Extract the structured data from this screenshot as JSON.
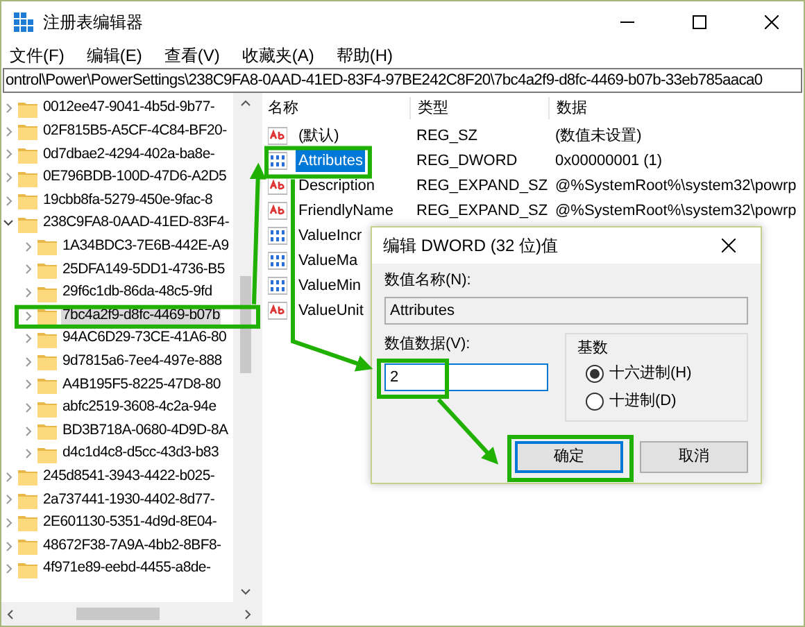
{
  "window": {
    "title": "注册表编辑器"
  },
  "menu": [
    "文件(F)",
    "编辑(E)",
    "查看(V)",
    "收藏夹(A)",
    "帮助(H)"
  ],
  "address": "ontrol\\Power\\PowerSettings\\238C9FA8-0AAD-41ED-83F4-97BE242C8F20\\7bc4a2f9-d8fc-4469-b07b-33eb785aaca0",
  "tree": {
    "items": [
      {
        "label": "0012ee47-9041-4b5d-9b77-",
        "expanded": false,
        "selected": false
      },
      {
        "label": "02F815B5-A5CF-4C84-BF20-",
        "expanded": false,
        "selected": false
      },
      {
        "label": "0d7dbae2-4294-402a-ba8e-",
        "expanded": false,
        "selected": false
      },
      {
        "label": "0E796BDB-100D-47D6-A2D5",
        "expanded": false,
        "selected": false
      },
      {
        "label": "19cbb8fa-5279-450e-9fac-8",
        "expanded": false,
        "selected": false
      },
      {
        "label": "238C9FA8-0AAD-41ED-83F4-",
        "expanded": true,
        "selected": false,
        "children": [
          {
            "label": "1A34BDC3-7E6B-442E-A9",
            "expanded": false,
            "selected": false
          },
          {
            "label": "25DFA149-5DD1-4736-B5",
            "expanded": false,
            "selected": false
          },
          {
            "label": "29f6c1db-86da-48c5-9fd",
            "expanded": false,
            "selected": false
          },
          {
            "label": "7bc4a2f9-d8fc-4469-b07b",
            "expanded": false,
            "selected": true
          },
          {
            "label": "94AC6D29-73CE-41A6-80",
            "expanded": false,
            "selected": false
          },
          {
            "label": "9d7815a6-7ee4-497e-888",
            "expanded": false,
            "selected": false
          },
          {
            "label": "A4B195F5-8225-47D8-80",
            "expanded": false,
            "selected": false
          },
          {
            "label": "abfc2519-3608-4c2a-94e",
            "expanded": false,
            "selected": false
          },
          {
            "label": "BD3B718A-0680-4D9D-8A",
            "expanded": false,
            "selected": false
          },
          {
            "label": "d4c1d4c8-d5cc-43d3-b83",
            "expanded": false,
            "selected": false
          }
        ]
      },
      {
        "label": "245d8541-3943-4422-b025-",
        "expanded": false,
        "selected": false
      },
      {
        "label": "2a737441-1930-4402-8d77-",
        "expanded": false,
        "selected": false
      },
      {
        "label": "2E601130-5351-4d9d-8E04-",
        "expanded": false,
        "selected": false
      },
      {
        "label": "48672F38-7A9A-4bb2-8BF8-",
        "expanded": false,
        "selected": false
      },
      {
        "label": "4f971e89-eebd-4455-a8de-",
        "expanded": false,
        "selected": false
      }
    ]
  },
  "values": {
    "columns": [
      "名称",
      "类型",
      "数据"
    ],
    "rows": [
      {
        "kind": "string",
        "name": "(默认)",
        "type": "REG_SZ",
        "data": "(数值未设置)",
        "selected": false
      },
      {
        "kind": "dword",
        "name": "Attributes",
        "type": "REG_DWORD",
        "data": "0x00000001 (1)",
        "selected": true
      },
      {
        "kind": "string",
        "name": "Description",
        "type": "REG_EXPAND_SZ",
        "data": "@%SystemRoot%\\system32\\powrp",
        "selected": false
      },
      {
        "kind": "string",
        "name": "FriendlyName",
        "type": "REG_EXPAND_SZ",
        "data": "@%SystemRoot%\\system32\\powrp",
        "selected": false
      },
      {
        "kind": "dword",
        "name": "ValueIncr",
        "selected": false
      },
      {
        "kind": "dword",
        "name": "ValueMa",
        "selected": false
      },
      {
        "kind": "dword",
        "name": "ValueMin",
        "selected": false
      },
      {
        "kind": "string",
        "name": "ValueUnit",
        "selected": false
      }
    ]
  },
  "dialog": {
    "title": "编辑 DWORD (32 位)值",
    "name_label": "数值名称(N):",
    "name_value": "Attributes",
    "data_label": "数值数据(V):",
    "data_value": "2",
    "base_label": "基数",
    "radios": [
      {
        "label": "十六进制(H)",
        "selected": true
      },
      {
        "label": "十进制(D)",
        "selected": false
      }
    ],
    "buttons": [
      "确定",
      "取消"
    ]
  }
}
